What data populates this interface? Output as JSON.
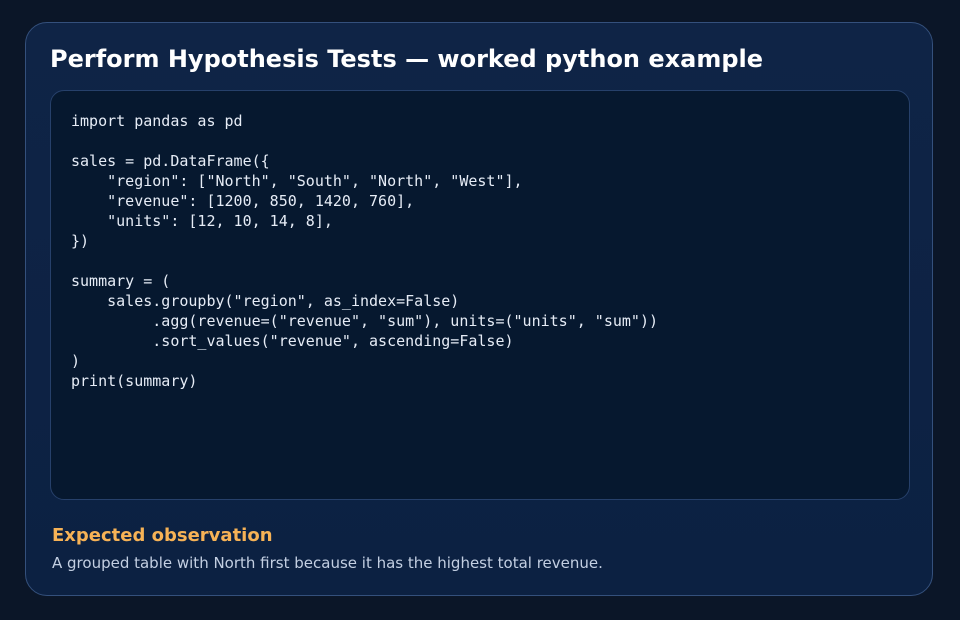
{
  "card": {
    "title": "Perform Hypothesis Tests — worked python example"
  },
  "code": {
    "language": "python",
    "text": "import pandas as pd\n\nsales = pd.DataFrame({\n    \"region\": [\"North\", \"South\", \"North\", \"West\"],\n    \"revenue\": [1200, 850, 1420, 760],\n    \"units\": [12, 10, 14, 8],\n})\n\nsummary = (\n    sales.groupby(\"region\", as_index=False)\n         .agg(revenue=(\"revenue\", \"sum\"), units=(\"units\", \"sum\"))\n         .sort_values(\"revenue\", ascending=False)\n)\nprint(summary)"
  },
  "observation": {
    "heading": "Expected observation",
    "text": "A grouped table with North first because it has the highest total revenue."
  },
  "colors": {
    "background": "#0b1628",
    "card": "#0e2345",
    "code_background": "#06182f",
    "accent": "#f6b256",
    "title": "#ffffff"
  }
}
